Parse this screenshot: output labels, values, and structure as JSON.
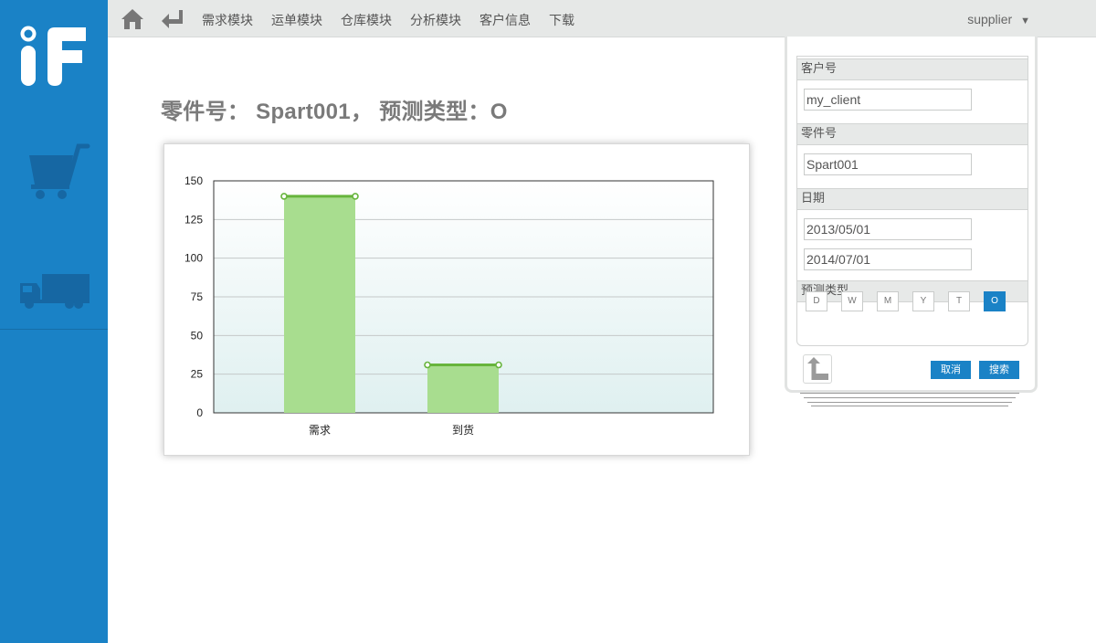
{
  "app": {
    "logo_text": "iF",
    "brand_color": "#1a82c6"
  },
  "sidebar": {
    "items": [
      {
        "icon": "shopping-cart-icon"
      },
      {
        "icon": "truck-icon"
      }
    ]
  },
  "nav": {
    "home_icon": "home-icon",
    "back_icon": "return-arrow-icon",
    "items": [
      {
        "label": "需求模块"
      },
      {
        "label": "运单模块"
      },
      {
        "label": "仓库模块"
      },
      {
        "label": "分析模块"
      },
      {
        "label": "客户信息"
      },
      {
        "label": "下载"
      }
    ],
    "user": "supplier",
    "user_caret": "▼"
  },
  "page": {
    "title": "零件号： Spart001， 预测类型：O"
  },
  "chart_data": {
    "type": "bar",
    "categories": [
      "需求",
      "到货"
    ],
    "values": [
      140,
      31
    ],
    "ylim": [
      0,
      150
    ],
    "yticks": [
      0,
      25,
      50,
      75,
      100,
      125,
      150
    ],
    "grid": true,
    "legend": "none",
    "bar_color": "#a8dd8f",
    "line_color": "#67b43c"
  },
  "search_panel": {
    "client_label": "客户号",
    "client_value": "my_client",
    "part_label": "零件号",
    "part_value": "Spart001",
    "date_label": "日期",
    "date_from": "2013/05/01",
    "date_to": "2014/07/01",
    "type_label": "预测类型",
    "types": [
      {
        "label": "D",
        "active": false
      },
      {
        "label": "W",
        "active": false
      },
      {
        "label": "M",
        "active": false
      },
      {
        "label": "Y",
        "active": false
      },
      {
        "label": "T",
        "active": false
      },
      {
        "label": "O",
        "active": true
      }
    ],
    "back_icon": "up-return-arrow-icon",
    "cancel_label": "取消",
    "search_label": "搜索"
  }
}
